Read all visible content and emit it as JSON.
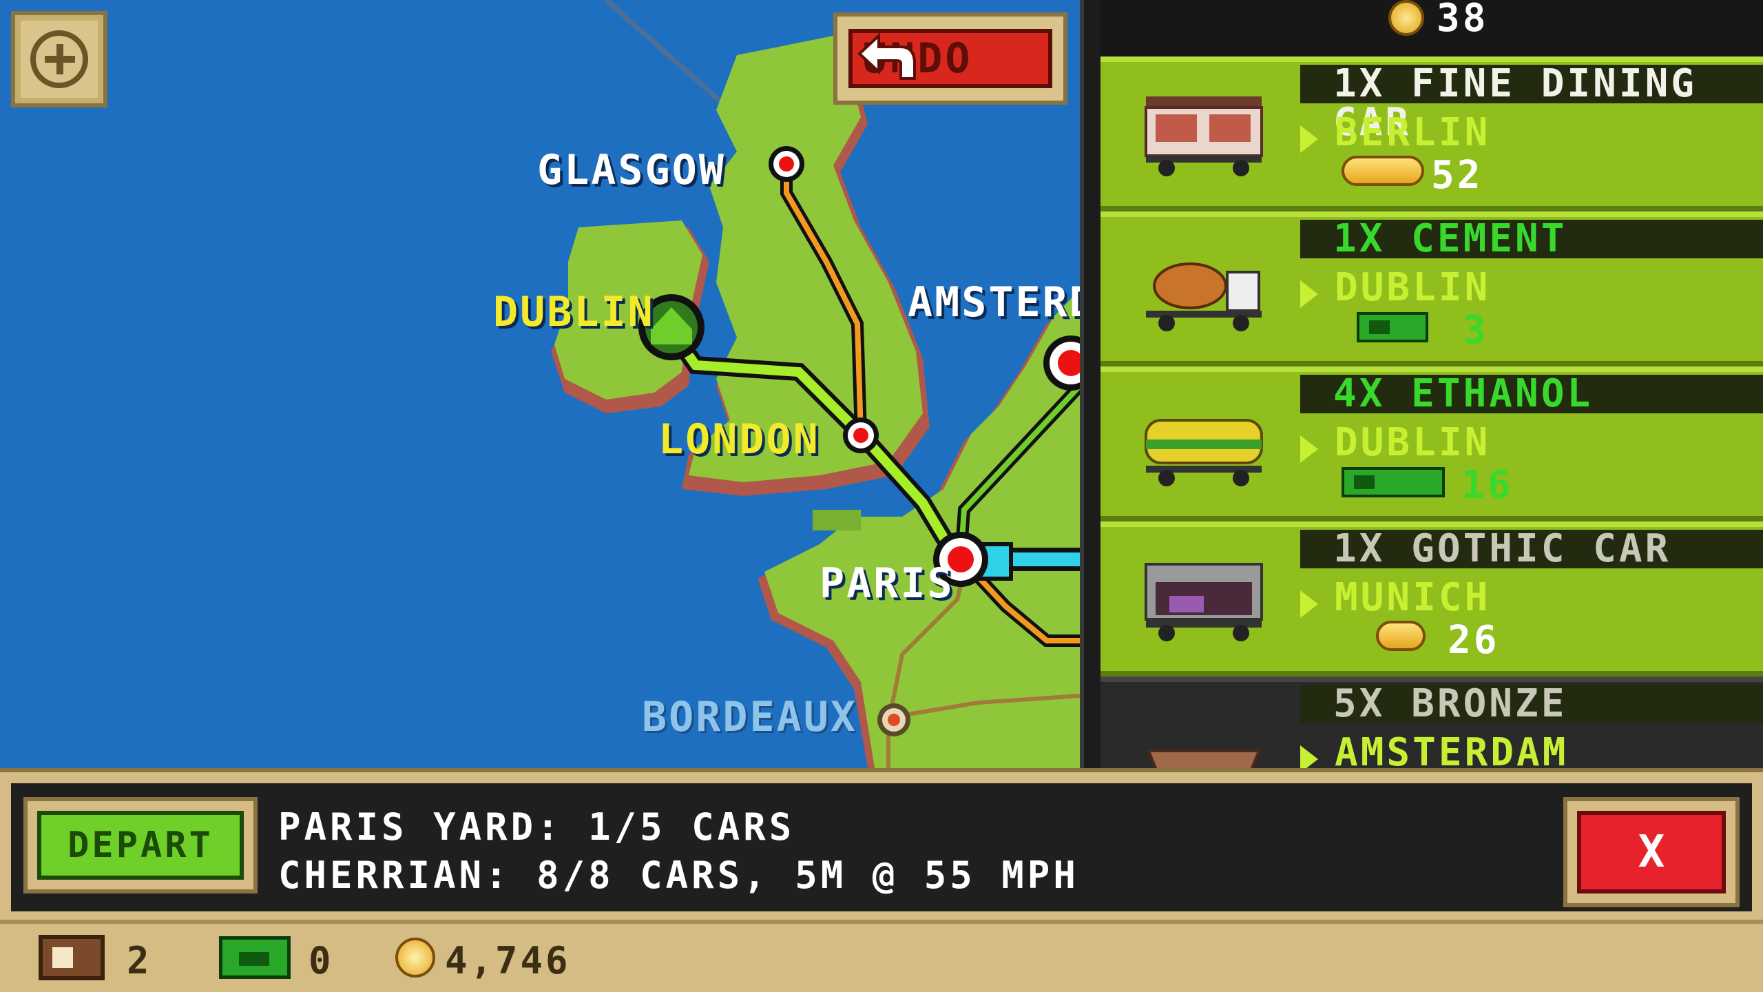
{
  "map": {
    "cities": [
      {
        "name": "GLASGOW",
        "style": "white"
      },
      {
        "name": "DUBLIN",
        "style": "yellow"
      },
      {
        "name": "AMSTERD",
        "style": "white"
      },
      {
        "name": "LONDON",
        "style": "yellow"
      },
      {
        "name": "PARIS",
        "style": "white"
      },
      {
        "name": "BORDEAUX",
        "style": "faded"
      }
    ],
    "undo_label": "UNDO",
    "colors": {
      "sea": "#1e6fc0",
      "land": "#8fc63a",
      "cliff": "#b0584a",
      "route_orange": "#f39a1e",
      "route_green": "#a6ee2a",
      "route_cyan": "#2fd2e8"
    }
  },
  "cargo_panel": {
    "top_partial_reward": "38",
    "rows": [
      {
        "title": "1X FINE DINING CAR",
        "title_style": "white",
        "destination": "BERLIN",
        "reward": "52",
        "reward_type": "gold",
        "car_icon": "dining-car-icon"
      },
      {
        "title": "1X CEMENT",
        "title_style": "green",
        "destination": "DUBLIN",
        "reward": "3",
        "reward_type": "cash",
        "car_icon": "cement-car-icon"
      },
      {
        "title": "4X ETHANOL",
        "title_style": "green",
        "destination": "DUBLIN",
        "reward": "16",
        "reward_type": "cash",
        "car_icon": "tanker-car-icon"
      },
      {
        "title": "1X GOTHIC CAR",
        "title_style": "grey",
        "destination": "MUNICH",
        "reward": "26",
        "reward_type": "gold",
        "car_icon": "gothic-car-icon"
      },
      {
        "title": "5X BRONZE",
        "title_style": "grey",
        "destination": "AMSTERDAM",
        "reward": "",
        "reward_type": "none",
        "car_icon": "hopper-car-icon"
      }
    ]
  },
  "info_bar": {
    "depart_label": "DEPART",
    "line1": "PARIS YARD: 1/5 CARS",
    "line2": "CHERRIAN: 8/8 CARS, 5M @ 55 MPH",
    "close_label": "X"
  },
  "status_bar": {
    "cars": "2",
    "cash": "0",
    "gold": "4,746"
  }
}
